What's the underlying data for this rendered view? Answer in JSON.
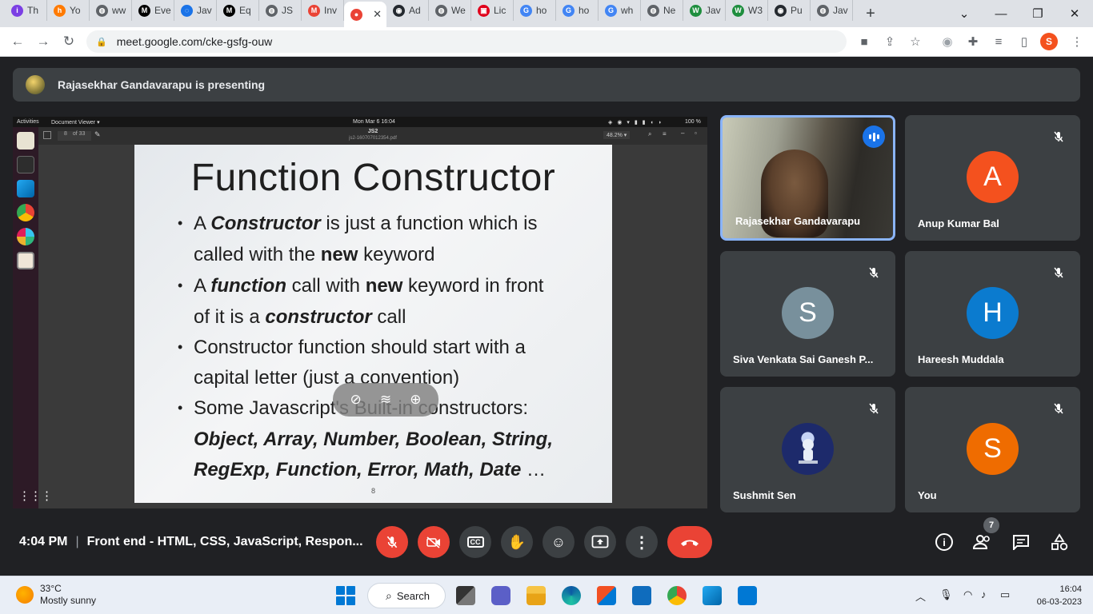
{
  "browser": {
    "tabs": [
      {
        "title": "Th",
        "color": "#7b3fe4",
        "glyph": "i"
      },
      {
        "title": "Yo",
        "color": "#ff7a00",
        "glyph": "h"
      },
      {
        "title": "ww",
        "color": "#5f6368",
        "glyph": "◍"
      },
      {
        "title": "Eve",
        "color": "#000000",
        "glyph": "M"
      },
      {
        "title": "Jav",
        "color": "#1a73e8",
        "glyph": "◌"
      },
      {
        "title": "Eq",
        "color": "#000000",
        "glyph": "M"
      },
      {
        "title": "JS",
        "color": "#5f6368",
        "glyph": "◍"
      },
      {
        "title": "Inv",
        "color": "#ea4335",
        "glyph": "M"
      },
      {
        "title": "",
        "color": "#ea4335",
        "glyph": "●"
      },
      {
        "title": "Ad",
        "color": "#24292f",
        "glyph": "◉"
      },
      {
        "title": "We",
        "color": "#5f6368",
        "glyph": "◍"
      },
      {
        "title": "Lic",
        "color": "#e0001b",
        "glyph": "▣"
      },
      {
        "title": "ho",
        "color": "#4285f4",
        "glyph": "G"
      },
      {
        "title": "ho",
        "color": "#4285f4",
        "glyph": "G"
      },
      {
        "title": "wh",
        "color": "#4285f4",
        "glyph": "G"
      },
      {
        "title": "Ne",
        "color": "#5f6368",
        "glyph": "◍"
      },
      {
        "title": "Jav",
        "color": "#1e8e3e",
        "glyph": "W"
      },
      {
        "title": "W3",
        "color": "#1e8e3e",
        "glyph": "W"
      },
      {
        "title": "Pu",
        "color": "#24292f",
        "glyph": "◉"
      },
      {
        "title": "Jav",
        "color": "#5f6368",
        "glyph": "◍"
      }
    ],
    "url": "meet.google.com/cke-gsfg-ouw",
    "profile_initial": "S"
  },
  "meet": {
    "presenter_banner": "Rajasekhar Gandavarapu is presenting",
    "slide": {
      "title": "Function Constructor",
      "bullet1_pre": "A ",
      "bullet1_em": "Constructor",
      "bullet1_post": " is just a function which is",
      "bullet1_line2_pre": "called with the ",
      "bullet1_line2_kw": "new",
      "bullet1_line2_post": " keyword",
      "bullet2_pre": "A ",
      "bullet2_em": "function",
      "bullet2_mid": " call with ",
      "bullet2_kw": "new",
      "bullet2_post": " keyword in front",
      "bullet2_line2_pre": "of it is a ",
      "bullet2_line2_em": "constructor",
      "bullet2_line2_post": " call",
      "bullet3_line1": "Constructor function should start with a",
      "bullet3_line2": "capital letter (just a convention)",
      "bullet4_line1": "Some Javascript's Built-in constructors:",
      "bullet4_line2": "Object, Array, Number, Boolean, String,",
      "bullet4_line3_em": "RegExp, Function, Error, Math, Date",
      "bullet4_line3_post": " …",
      "page_number": "8"
    },
    "viewer": {
      "activities": "Activities",
      "app_menu": "Document Viewer ▾",
      "datetime": "Mon Mar 6  16:04",
      "doc_title": "JS2",
      "doc_file": "js2-160707012354.pdf",
      "page_field": "8",
      "page_total": "of 33",
      "zoom": "48.2% ▾",
      "battery": "100 %"
    },
    "participants": [
      {
        "name": "Rajasekhar Gandavarapu",
        "initial": "",
        "color": ""
      },
      {
        "name": "Anup Kumar Bal",
        "initial": "A",
        "color": "#f4511e"
      },
      {
        "name": "Siva Venkata Sai Ganesh P...",
        "initial": "S",
        "color": "#78909c"
      },
      {
        "name": "Hareesh Muddala",
        "initial": "H",
        "color": "#0b7bcf"
      },
      {
        "name": "Sushmit Sen",
        "initial": "",
        "color": ""
      },
      {
        "name": "You",
        "initial": "S",
        "color": "#ef6c00"
      }
    ],
    "clock": "4:04 PM",
    "separator": "|",
    "meeting_title": "Front end - HTML, CSS, JavaScript, Respon...",
    "people_count": "7"
  },
  "taskbar": {
    "temperature": "33°C",
    "weather": "Mostly sunny",
    "search_label": "Search",
    "time": "16:04",
    "date": "06-03-2023"
  }
}
